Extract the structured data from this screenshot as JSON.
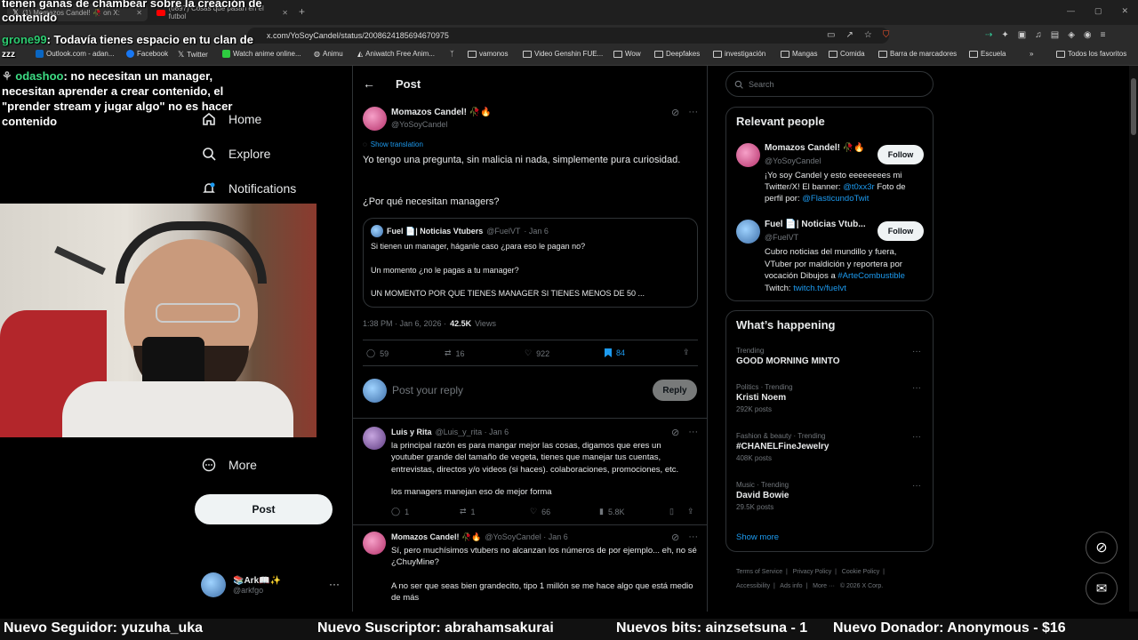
{
  "browser": {
    "tabs": [
      {
        "label": "(1) Momazos Candel! 🥀 on X:"
      },
      {
        "label": "(6897) Cosas que pasan en el futbol"
      }
    ],
    "url": "x.com/YoSoyCandel/status/2008624185694670975",
    "bookmarks": [
      {
        "label": "Outlook.com - adan...",
        "icon": "outlook-icon",
        "color": "#0a66c2"
      },
      {
        "label": "Facebook",
        "icon": "facebook-icon",
        "color": "#1877f2"
      },
      {
        "label": "Twitter",
        "icon": "x-icon",
        "color": "#000000"
      },
      {
        "label": "Watch anime online...",
        "icon": "anime-icon",
        "color": "#2ecc40"
      },
      {
        "label": "Animu",
        "icon": "globe-icon",
        "color": "#cccccc"
      },
      {
        "label": "Aniwatch Free Anim...",
        "icon": "aniwatch-icon",
        "color": "#cccccc"
      },
      {
        "label": "vamonos",
        "icon": "folder-icon"
      },
      {
        "label": "Video Genshin FUE...",
        "icon": "folder-icon"
      },
      {
        "label": "Wow",
        "icon": "folder-icon"
      },
      {
        "label": "Deepfakes",
        "icon": "folder-icon"
      },
      {
        "label": "investigación",
        "icon": "folder-icon"
      },
      {
        "label": "Mangas",
        "icon": "folder-icon"
      },
      {
        "label": "Comida",
        "icon": "folder-icon"
      },
      {
        "label": "Barra de marcadores",
        "icon": "folder-icon"
      },
      {
        "label": "Escuela",
        "icon": "folder-icon"
      }
    ],
    "all_bookmarks": "Todos los favoritos"
  },
  "stream_chat": {
    "top_line": "tienen ganas de chambear sobre la creación de contenido",
    "messages": [
      {
        "user": "grone99",
        "user_color": "#2ecc71",
        "text": "Todavía tienes espacio en tu clan de"
      },
      {
        "user": "odashoo",
        "user_color": "#3ddc84",
        "text": "no necesitan un manager, necesitan aprender a crear contenido, el \"prender stream y jugar algo\" no es hacer contenido"
      }
    ],
    "overlay_zzz": "zzz"
  },
  "left_nav": {
    "items": [
      {
        "label": "Home",
        "icon": "home-icon"
      },
      {
        "label": "Explore",
        "icon": "search-icon"
      },
      {
        "label": "Notifications",
        "icon": "bell-icon"
      }
    ],
    "more_label": "More",
    "post_button": "Post",
    "account": {
      "name": "📚Ark📖✨",
      "handle": "@arkfgo"
    }
  },
  "post": {
    "header_title": "Post",
    "author_name": "Momazos Candel! 🥀🔥",
    "author_handle": "@YoSoyCandel",
    "show_translation": "Show translation",
    "text_line1": "Yo tengo una pregunta, sin malicia ni nada, simplemente pura curiosidad.",
    "text_line2": "¿Por qué necesitan managers?",
    "quote": {
      "name": "Fuel 📄| Noticias Vtubers",
      "handle": "@FuelVT",
      "date": "· Jan 6",
      "line1": "Si tienen un manager, háganle caso ¿para eso le pagan no?",
      "line2": "Un momento ¿no le pagas a tu manager?",
      "line3": "UN MOMENTO POR QUE TIENES MANAGER SI TIENES MENOS DE 50 ..."
    },
    "timestamp": "1:38 PM · Jan 6, 2026 ·",
    "views_count": "42.5K",
    "views_label": "Views",
    "replies": "59",
    "reposts": "16",
    "likes": "922",
    "bookmarks": "84",
    "reply_placeholder": "Post your reply",
    "reply_button": "Reply"
  },
  "replies": [
    {
      "name": "Luis y Rita",
      "handle": "@Luis_y_rita · Jan 6",
      "text": "la principal razón es para mangar mejor las cosas, digamos que eres un youtuber grande del tamaño de vegeta, tienes que manejar tus cuentas, entrevistas, directos y/o videos (si haces). colaboraciones, promociones, etc.",
      "text2": "los managers manejan eso de mejor forma",
      "replies": "1",
      "reposts": "1",
      "likes": "66",
      "views": "5.8K"
    },
    {
      "name": "Momazos Candel! 🥀🔥",
      "handle": "@YoSoyCandel · Jan 6",
      "text": "Sí, pero muchísimos vtubers no alcanzan los números de por ejemplo... eh, no sé ¿ChuyMine?",
      "text2": "A no ser que seas bien grandecito, tipo 1 millón se me hace algo que está medio de más"
    }
  ],
  "sidebar": {
    "search_placeholder": "Search",
    "relevant_title": "Relevant people",
    "people": [
      {
        "name": "Momazos Candel! 🥀🔥",
        "handle": "@YoSoyCandel",
        "follow": "Follow",
        "bio_pre": "¡Yo soy Candel y esto eeeeeeees mi Twitter/X! El banner: ",
        "bio_link1": "@t0xx3r",
        "bio_mid": " Foto de perfil por: ",
        "bio_link2": "@FlasticundoTwit"
      },
      {
        "name": "Fuel 📄| Noticias Vtub...",
        "handle": "@FuelVT",
        "follow": "Follow",
        "bio_pre": "Cubro noticias del mundillo y fuera, VTuber por maldición y reportera por vocación Dibujos a ",
        "bio_link1": "#ArteCombustible",
        "bio_mid": " Twitch: ",
        "bio_link2": "twitch.tv/fuelvt"
      }
    ],
    "happening_title": "What’s happening",
    "trends": [
      {
        "category": "Trending",
        "name": "GOOD MORNING MINTO",
        "count": ""
      },
      {
        "category": "Politics · Trending",
        "name": "Kristi Noem",
        "count": "292K posts"
      },
      {
        "category": "Fashion & beauty · Trending",
        "name": "#CHANELFineJewelry",
        "count": "408K posts"
      },
      {
        "category": "Music · Trending",
        "name": "David Bowie",
        "count": "29.5K posts"
      }
    ],
    "show_more": "Show more",
    "footer_links": [
      "Terms of Service",
      "Privacy Policy",
      "Cookie Policy",
      "Accessibility",
      "Ads info",
      "More ···",
      "© 2026 X Corp."
    ]
  },
  "stream_footer": {
    "follower": "Nuevo Seguidor: yuzuha_uka",
    "subscriber": "Nuevo Suscriptor: abrahamsakurai",
    "bits": "Nuevos bits: ainzsetsuna - 1",
    "donor": "Nuevo Donador: Anonymous - $16"
  }
}
